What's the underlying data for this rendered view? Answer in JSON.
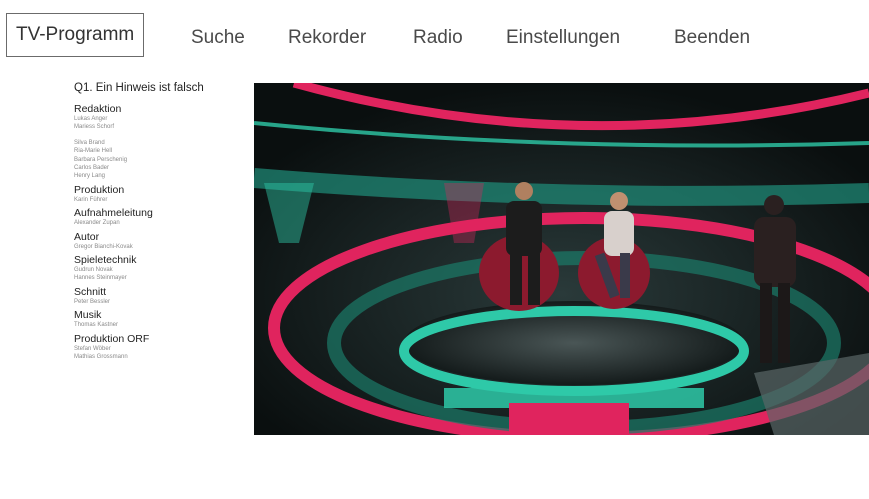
{
  "nav": {
    "items": [
      {
        "label": "TV-Programm",
        "active": true
      },
      {
        "label": "Suche",
        "active": false
      },
      {
        "label": "Rekorder",
        "active": false
      },
      {
        "label": "Radio",
        "active": false
      },
      {
        "label": "Einstellungen",
        "active": false
      },
      {
        "label": "Beenden",
        "active": false
      }
    ]
  },
  "credits": {
    "title": "Q1. Ein Hinweis ist falsch",
    "sections": [
      {
        "heading": "Redaktion",
        "names": [
          "Lukas Anger",
          "Mariess Schorf"
        ]
      },
      {
        "heading": "",
        "names": [
          "Silva Brand",
          "Ria-Marie Hell",
          "Barbara Perschenig",
          "Carlos Bader",
          "Henry Lang"
        ]
      },
      {
        "heading": "Produktion",
        "names": [
          "Karin Führer"
        ]
      },
      {
        "heading": "Aufnahmeleitung",
        "names": [
          "Alexander Zupan"
        ]
      },
      {
        "heading": "Autor",
        "names": [
          "Gregor Bianchi-Kovak"
        ]
      },
      {
        "heading": "Spieletechnik",
        "names": [
          "Gudrun Novak",
          "Hannes Steinmayer"
        ]
      },
      {
        "heading": "Schnitt",
        "names": [
          "Peter Bessler"
        ]
      },
      {
        "heading": "Musik",
        "names": [
          "Thomas Kastner"
        ]
      },
      {
        "heading": "Produktion ORF",
        "names": [
          "Stefan Wöber",
          "Mathias Grossmann"
        ]
      }
    ]
  },
  "video": {
    "description_icon": "tv-studio-frame",
    "colors": {
      "neon_pink": "#e0245e",
      "neon_teal": "#2ec9a8",
      "studio_dark": "#0c1111"
    }
  }
}
